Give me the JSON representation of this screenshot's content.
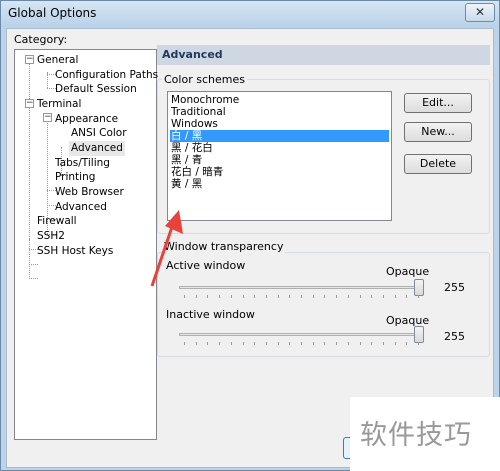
{
  "window": {
    "title": "Global Options",
    "close_glyph": "✕"
  },
  "category": {
    "label": "Category:",
    "tree": [
      {
        "label": "General",
        "expander": "−"
      },
      {
        "label": "Configuration Paths"
      },
      {
        "label": "Default Session"
      },
      {
        "label": "Terminal",
        "expander": "−"
      },
      {
        "label": "Appearance",
        "expander": "−"
      },
      {
        "label": "ANSI Color"
      },
      {
        "label": "Advanced"
      },
      {
        "label": "Tabs/Tiling"
      },
      {
        "label": "Printing"
      },
      {
        "label": "Web Browser"
      },
      {
        "label": "Advanced"
      },
      {
        "label": "Firewall"
      },
      {
        "label": "SSH2"
      },
      {
        "label": "SSH Host Keys"
      }
    ]
  },
  "panel": {
    "header": "Advanced",
    "color_schemes": {
      "label": "Color schemes",
      "items": [
        "Monochrome",
        "Traditional",
        "Windows",
        "白 / 黑",
        "黑 / 花白",
        "黑 / 青",
        "花白 / 暗青",
        "黄 / 黑"
      ],
      "selected": "白 / 黑",
      "buttons": {
        "edit": "Edit...",
        "new": "New...",
        "delete": "Delete"
      }
    },
    "transparency": {
      "label": "Window transparency",
      "active": {
        "label": "Active window",
        "level_label": "Opaque",
        "value": "255"
      },
      "inactive": {
        "label": "Inactive window",
        "level_label": "Opaque",
        "value": "255"
      }
    }
  },
  "overlay": {
    "watermark": "软件技巧",
    "arrow_color": "#e8423a"
  },
  "colors": {
    "selection": "#3399ff",
    "title_bar": "#c6dbee"
  }
}
